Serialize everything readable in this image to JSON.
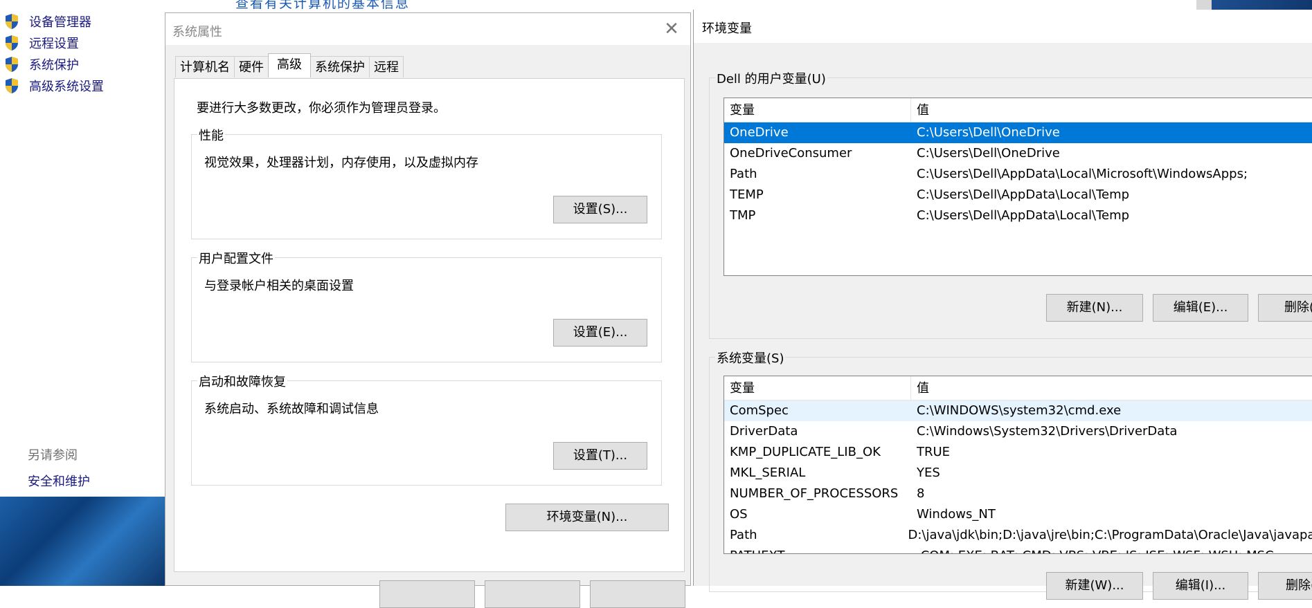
{
  "control_panel": {
    "partial_top_text": "查看有关计算机的基本信息",
    "links": [
      {
        "label": "设备管理器",
        "icon": "uac-shield-icon"
      },
      {
        "label": "远程设置",
        "icon": "uac-shield-icon"
      },
      {
        "label": "系统保护",
        "icon": "uac-shield-icon"
      },
      {
        "label": "高级系统设置",
        "icon": "uac-shield-icon"
      }
    ],
    "see_also": "另请参阅",
    "security_link": "安全和维护"
  },
  "system_properties": {
    "title": "系统属性",
    "tabs": [
      "计算机名",
      "硬件",
      "高级",
      "系统保护",
      "远程"
    ],
    "active_tab": "高级",
    "admin_note": "要进行大多数更改，你必须作为管理员登录。",
    "performance": {
      "title": "性能",
      "desc": "视觉效果，处理器计划，内存使用，以及虚拟内存",
      "button": "设置(S)..."
    },
    "user_profiles": {
      "title": "用户配置文件",
      "desc": "与登录帐户相关的桌面设置",
      "button": "设置(E)..."
    },
    "startup_recovery": {
      "title": "启动和故障恢复",
      "desc": "系统启动、系统故障和调试信息",
      "button": "设置(T)..."
    },
    "env_button": "环境变量(N)..."
  },
  "env_dialog": {
    "title": "环境变量",
    "user_group_title": "Dell 的用户变量(U)",
    "system_group_title": "系统变量(S)",
    "col_name": "变量",
    "col_value": "值",
    "user_vars": [
      {
        "name": "OneDrive",
        "value": "C:\\Users\\Dell\\OneDrive"
      },
      {
        "name": "OneDriveConsumer",
        "value": "C:\\Users\\Dell\\OneDrive"
      },
      {
        "name": "Path",
        "value": "C:\\Users\\Dell\\AppData\\Local\\Microsoft\\WindowsApps;"
      },
      {
        "name": "TEMP",
        "value": "C:\\Users\\Dell\\AppData\\Local\\Temp"
      },
      {
        "name": "TMP",
        "value": "C:\\Users\\Dell\\AppData\\Local\\Temp"
      }
    ],
    "system_vars": [
      {
        "name": "ComSpec",
        "value": "C:\\WINDOWS\\system32\\cmd.exe"
      },
      {
        "name": "DriverData",
        "value": "C:\\Windows\\System32\\Drivers\\DriverData"
      },
      {
        "name": "KMP_DUPLICATE_LIB_OK",
        "value": "TRUE"
      },
      {
        "name": "MKL_SERIAL",
        "value": "YES"
      },
      {
        "name": "NUMBER_OF_PROCESSORS",
        "value": "8"
      },
      {
        "name": "OS",
        "value": "Windows_NT"
      },
      {
        "name": "Path",
        "value": "D:\\java\\jdk\\bin;D:\\java\\jre\\bin;C:\\ProgramData\\Oracle\\Java\\javapath;"
      },
      {
        "name": "PATHEXT",
        "value": ".COM;.EXE;.BAT;.CMD;.VBS;.VBE;.JS;.JSE;.WSF;.WSH;.MSC"
      }
    ],
    "user_buttons": {
      "new": "新建(N)...",
      "edit": "编辑(E)...",
      "delete": "删除(D)"
    },
    "system_buttons": {
      "new": "新建(W)...",
      "edit": "编辑(I)...",
      "delete": "删除(L)"
    }
  },
  "colors": {
    "selection": "#0078d7",
    "link": "#1a1a80",
    "dialog_bg": "#f0f0f0"
  }
}
